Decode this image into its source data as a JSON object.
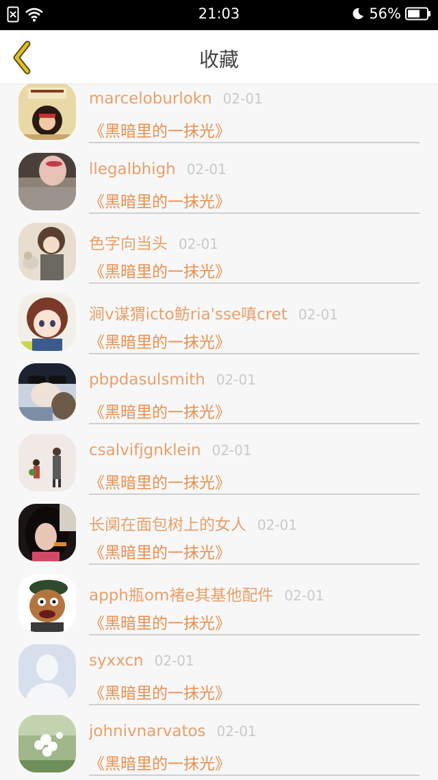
{
  "status_bar": {
    "time": "21:03",
    "battery": "56%",
    "icons": [
      "sim-off-icon",
      "wifi-icon",
      "moon-icon",
      "battery-icon"
    ]
  },
  "nav": {
    "title": "收藏",
    "back_icon": "chevron-left-icon",
    "accent_color": "#e0c020"
  },
  "favorites": [
    {
      "user": "marceloburlokn",
      "date": "02-01",
      "title": "《黑暗里的一抹光》",
      "avatar": "avatar-1"
    },
    {
      "user": "llegalbhigh",
      "date": "02-01",
      "title": "《黑暗里的一抹光》",
      "avatar": "avatar-2"
    },
    {
      "user": "色字向当头",
      "date": "02-01",
      "title": "《黑暗里的一抹光》",
      "avatar": "avatar-3"
    },
    {
      "user": "涧v谋猬icto鲂ria'sse嗔cret",
      "date": "02-01",
      "title": "《黑暗里的一抹光》",
      "avatar": "avatar-4"
    },
    {
      "user": "pbpdasulsmith",
      "date": "02-01",
      "title": "《黑暗里的一抹光》",
      "avatar": "avatar-5"
    },
    {
      "user": "csalvifjgnklein",
      "date": "02-01",
      "title": "《黑暗里的一抹光》",
      "avatar": "avatar-6"
    },
    {
      "user": "长阒在面包树上的女人",
      "date": "02-01",
      "title": "《黑暗里的一抹光》",
      "avatar": "avatar-7"
    },
    {
      "user": "apph瓶om褚e其基他配件",
      "date": "02-01",
      "title": "《黑暗里的一抹光》",
      "avatar": "avatar-8"
    },
    {
      "user": "syxxcn",
      "date": "02-01",
      "title": "《黑暗里的一抹光》",
      "avatar": "default-avatar"
    },
    {
      "user": "johnivnarvatos",
      "date": "02-01",
      "title": "《黑暗里的一抹光》",
      "avatar": "avatar-10"
    }
  ],
  "colors": {
    "name": "#e8a06a",
    "title": "#e8904f",
    "date": "#c9c9c9"
  }
}
